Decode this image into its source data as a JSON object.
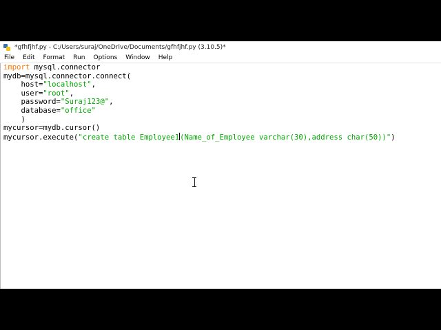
{
  "window": {
    "title": "*gfhfjhf.py - C:/Users/suraj/OneDrive/Documents/gfhfjhf.py (3.10.5)*"
  },
  "menu": [
    "File",
    "Edit",
    "Format",
    "Run",
    "Options",
    "Window",
    "Help"
  ],
  "code": {
    "l1_kw": "import",
    "l1_rest": " mysql.connector",
    "l2": "mydb=mysql.connector.connect(",
    "l3_pre": "    host=",
    "l3_str": "\"localhost\"",
    "l3_post": ",",
    "l4_pre": "    user=",
    "l4_str": "\"root\"",
    "l4_post": ",",
    "l5_pre": "    password=",
    "l5_str": "\"Suraj123@\"",
    "l5_post": ",",
    "l6_pre": "    database=",
    "l6_str": "\"office\"",
    "l7": "    )",
    "l8": "mycursor=mydb.cursor()",
    "l9_pre": "mycursor.execute(",
    "l9_str_a": "\"create table Employee1",
    "l9_str_b": "(Name_of_Employee varchar(30),address char(50))\"",
    "l9_post": ")"
  },
  "icons": {
    "app": "python-idle-icon",
    "cursor": "text-cursor-icon"
  }
}
